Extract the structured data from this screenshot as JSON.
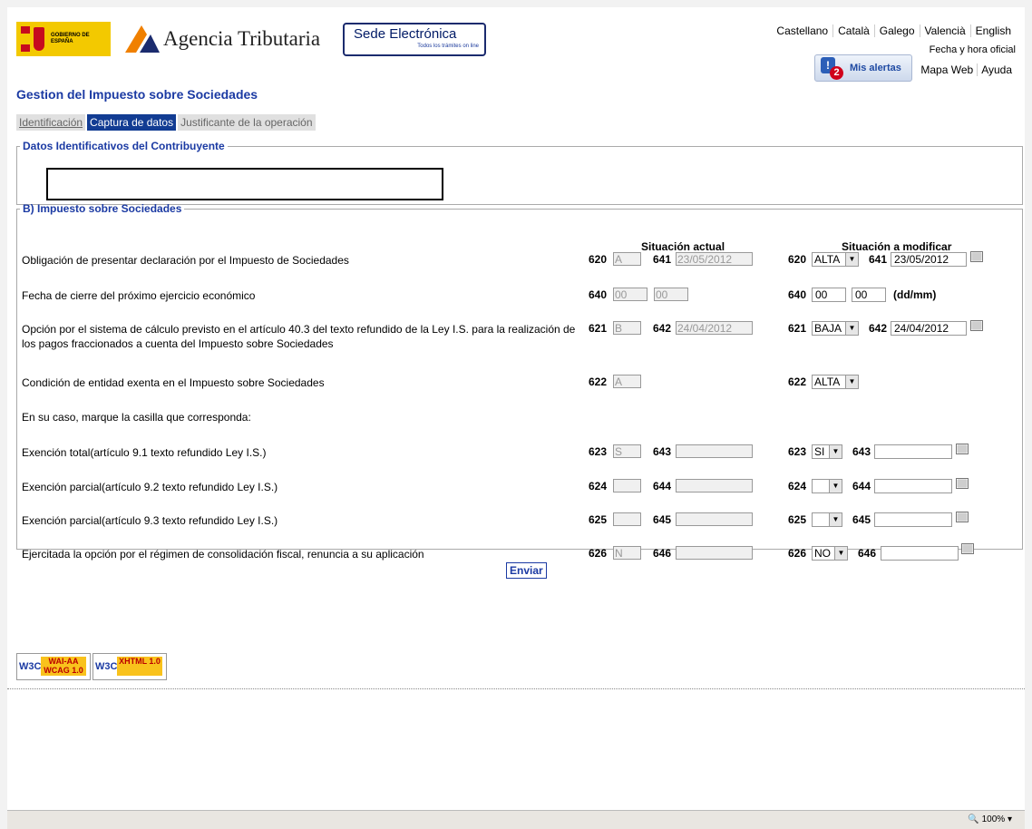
{
  "header": {
    "gov_logo_text": "GOBIERNO DE ESPAÑA",
    "app_name": "Agencia Tributaria",
    "sede_title": "Sede Electrónica",
    "sede_subtitle": "Todos los trámites on line",
    "languages": [
      "Castellano",
      "Català",
      "Galego",
      "Valencià",
      "English"
    ],
    "official_time": "Fecha y hora oficial",
    "alerts_count": "2",
    "alerts_label": "Mis alertas",
    "links": [
      "Mapa Web",
      "Ayuda"
    ]
  },
  "page_title": "Gestion del Impuesto sobre Sociedades",
  "steps": [
    "Identificación",
    "Captura de datos",
    "Justificante de la operación"
  ],
  "section1": {
    "legend": "Datos Identificativos del Contribuyente",
    "value": ""
  },
  "section2": {
    "legend": "B) Impuesto sobre Sociedades",
    "col_actual": "Situación actual",
    "col_modificar": "Situación a modificar",
    "rows": [
      {
        "label": "Obligación de presentar declaración por el Impuesto de Sociedades",
        "c1": "620",
        "v1": "A",
        "c2": "641",
        "v2": "23/05/2012",
        "m1": "620",
        "s1": "ALTA",
        "m2": "641",
        "s2": "23/05/2012"
      },
      {
        "label": "Fecha de cierre del próximo ejercicio económico",
        "c1": "640",
        "v1": "00",
        "v2": "00",
        "m1": "640",
        "s1": "00",
        "s2": "00",
        "note": "(dd/mm)"
      },
      {
        "label": "Opción por el sistema de cálculo previsto en el artículo 40.3 del texto refundido de la Ley I.S. para la realización de los pagos fraccionados a cuenta del Impuesto sobre Sociedades",
        "c1": "621",
        "v1": "B",
        "c2": "642",
        "v2": "24/04/2012",
        "m1": "621",
        "s1": "BAJA",
        "m2": "642",
        "s2": "24/04/2012"
      },
      {
        "label": "Condición de entidad exenta en el Impuesto sobre Sociedades",
        "c1": "622",
        "v1": "A",
        "m1": "622",
        "s1": "ALTA"
      },
      {
        "label": "En su caso, marque la casilla que corresponda:"
      },
      {
        "label": "Exención total(artículo 9.1 texto refundido Ley I.S.)",
        "c1": "623",
        "v1": "S",
        "c2": "643",
        "v2": "",
        "m1": "623",
        "s1": "SI",
        "m2": "643",
        "s2": ""
      },
      {
        "label": "Exención parcial(artículo 9.2 texto refundido Ley I.S.)",
        "c1": "624",
        "v1": "",
        "c2": "644",
        "v2": "",
        "m1": "624",
        "s1": "",
        "m2": "644",
        "s2": ""
      },
      {
        "label": "Exención parcial(artículo 9.3 texto refundido Ley I.S.)",
        "c1": "625",
        "v1": "",
        "c2": "645",
        "v2": "",
        "m1": "625",
        "s1": "",
        "m2": "645",
        "s2": ""
      },
      {
        "label": "Ejercitada la opción por el régimen de consolidación fiscal, renuncia a su aplicación",
        "c1": "626",
        "v1": "N",
        "c2": "646",
        "v2": "",
        "m1": "626",
        "s1": "NO",
        "m2": "646",
        "s2": ""
      }
    ]
  },
  "submit_label": "Enviar",
  "badges": {
    "w3c": "W3C",
    "wai": "WAI-AA WCAG 1.0",
    "xhtml": "XHTML 1.0"
  },
  "statusbar": {
    "zoom": "100%"
  }
}
